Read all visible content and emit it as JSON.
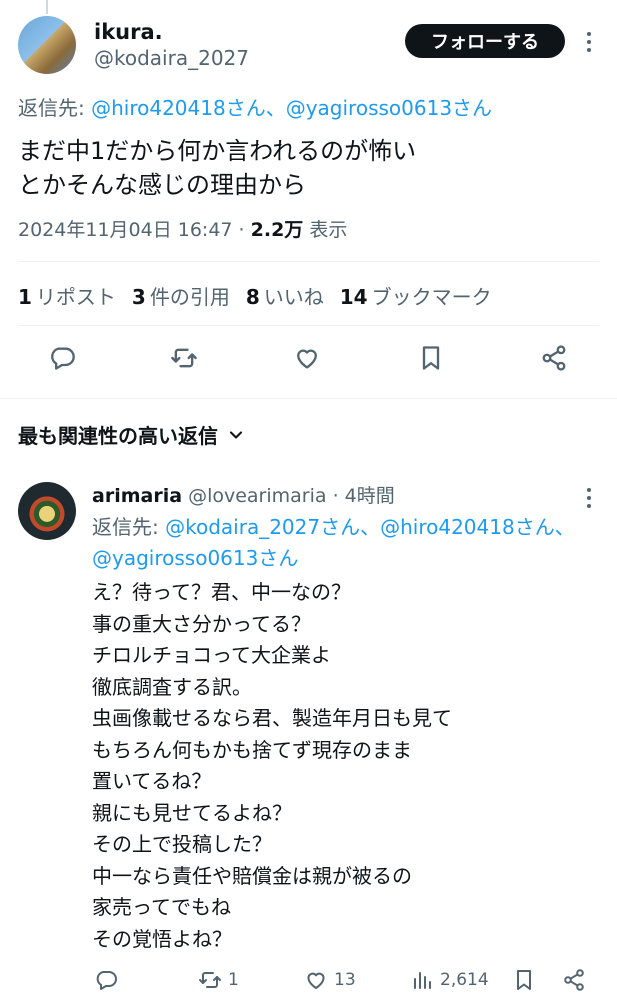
{
  "main_tweet": {
    "display_name": "ikura.",
    "handle": "@kodaira_2027",
    "follow_label": "フォローする",
    "reply_prefix": "返信先: ",
    "reply_to": "@hiro420418さん、@yagirosso0613さん",
    "text": "まだ中1だから何か言われるのが怖い\nとかそんな感じの理由から",
    "timestamp": "2024年11月04日 16:47 · ",
    "views_count": "2.2万",
    "views_label": " 表示",
    "stats": [
      {
        "count": "1",
        "label": "リポスト"
      },
      {
        "count": "3",
        "label": "件の引用"
      },
      {
        "count": "8",
        "label": "いいね"
      },
      {
        "count": "14",
        "label": "ブックマーク"
      }
    ]
  },
  "sort": {
    "label": "最も関連性の高い返信"
  },
  "reply_tweet": {
    "display_name": "arimaria",
    "handle": "@lovearimaria",
    "time": " · 4時間",
    "reply_prefix": "返信先: ",
    "reply_to": "@kodaira_2027さん、@hiro420418さん、@yagirosso0613さん",
    "text": "え？待って？君、中一なの？\n事の重大さ分かってる？\nチロルチョコって大企業よ\n徹底調査する訳。\n虫画像載せるなら君、製造年月日も見て\nもちろん何もかも捨てず現存のまま\n置いてるね？\n親にも見せてるよね？\nその上で投稿した？\n中一なら責任や賠償金は親が被るの\n家売ってでもね\nその覚悟よね？",
    "retweet_count": "1",
    "like_count": "13",
    "view_count": "2,614"
  },
  "colors": {
    "text_primary": "#0f1419",
    "text_secondary": "#536471",
    "link": "#1d9bf0",
    "button_dark": "#0f1419"
  }
}
